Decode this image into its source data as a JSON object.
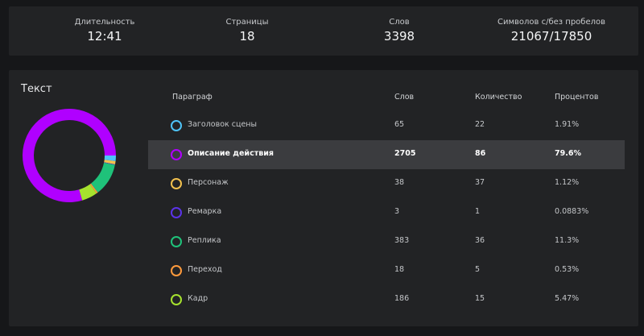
{
  "stats": [
    {
      "label": "Длительность",
      "value": "12:41"
    },
    {
      "label": "Страницы",
      "value": "18"
    },
    {
      "label": "Слов",
      "value": "3398"
    },
    {
      "label": "Символов с/без пробелов",
      "value": "21067/17850"
    }
  ],
  "text_panel": {
    "title": "Текст",
    "columns": {
      "paragraph": "Параграф",
      "words": "Слов",
      "count": "Количество",
      "percent": "Процентов"
    },
    "rows": [
      {
        "paragraph": "Заголовок сцены",
        "words": "65",
        "count": "22",
        "percent": "1.91%",
        "color": "#4fc3f7",
        "share": 1.91
      },
      {
        "paragraph": "Описание действия",
        "words": "2705",
        "count": "86",
        "percent": "79.6%",
        "color": "#b000ff",
        "share": 79.6,
        "selected": true
      },
      {
        "paragraph": "Персонаж",
        "words": "38",
        "count": "37",
        "percent": "1.12%",
        "color": "#f2c14e",
        "share": 1.12
      },
      {
        "paragraph": "Ремарка",
        "words": "3",
        "count": "1",
        "percent": "0.0883%",
        "color": "#5b33e8",
        "share": 0.0883
      },
      {
        "paragraph": "Реплика",
        "words": "383",
        "count": "36",
        "percent": "11.3%",
        "color": "#1fc27a",
        "share": 11.3
      },
      {
        "paragraph": "Переход",
        "words": "18",
        "count": "5",
        "percent": "0.53%",
        "color": "#ff9a3c",
        "share": 0.53
      },
      {
        "paragraph": "Кадр",
        "words": "186",
        "count": "15",
        "percent": "5.47%",
        "color": "#a6e22e",
        "share": 5.47
      }
    ]
  }
}
